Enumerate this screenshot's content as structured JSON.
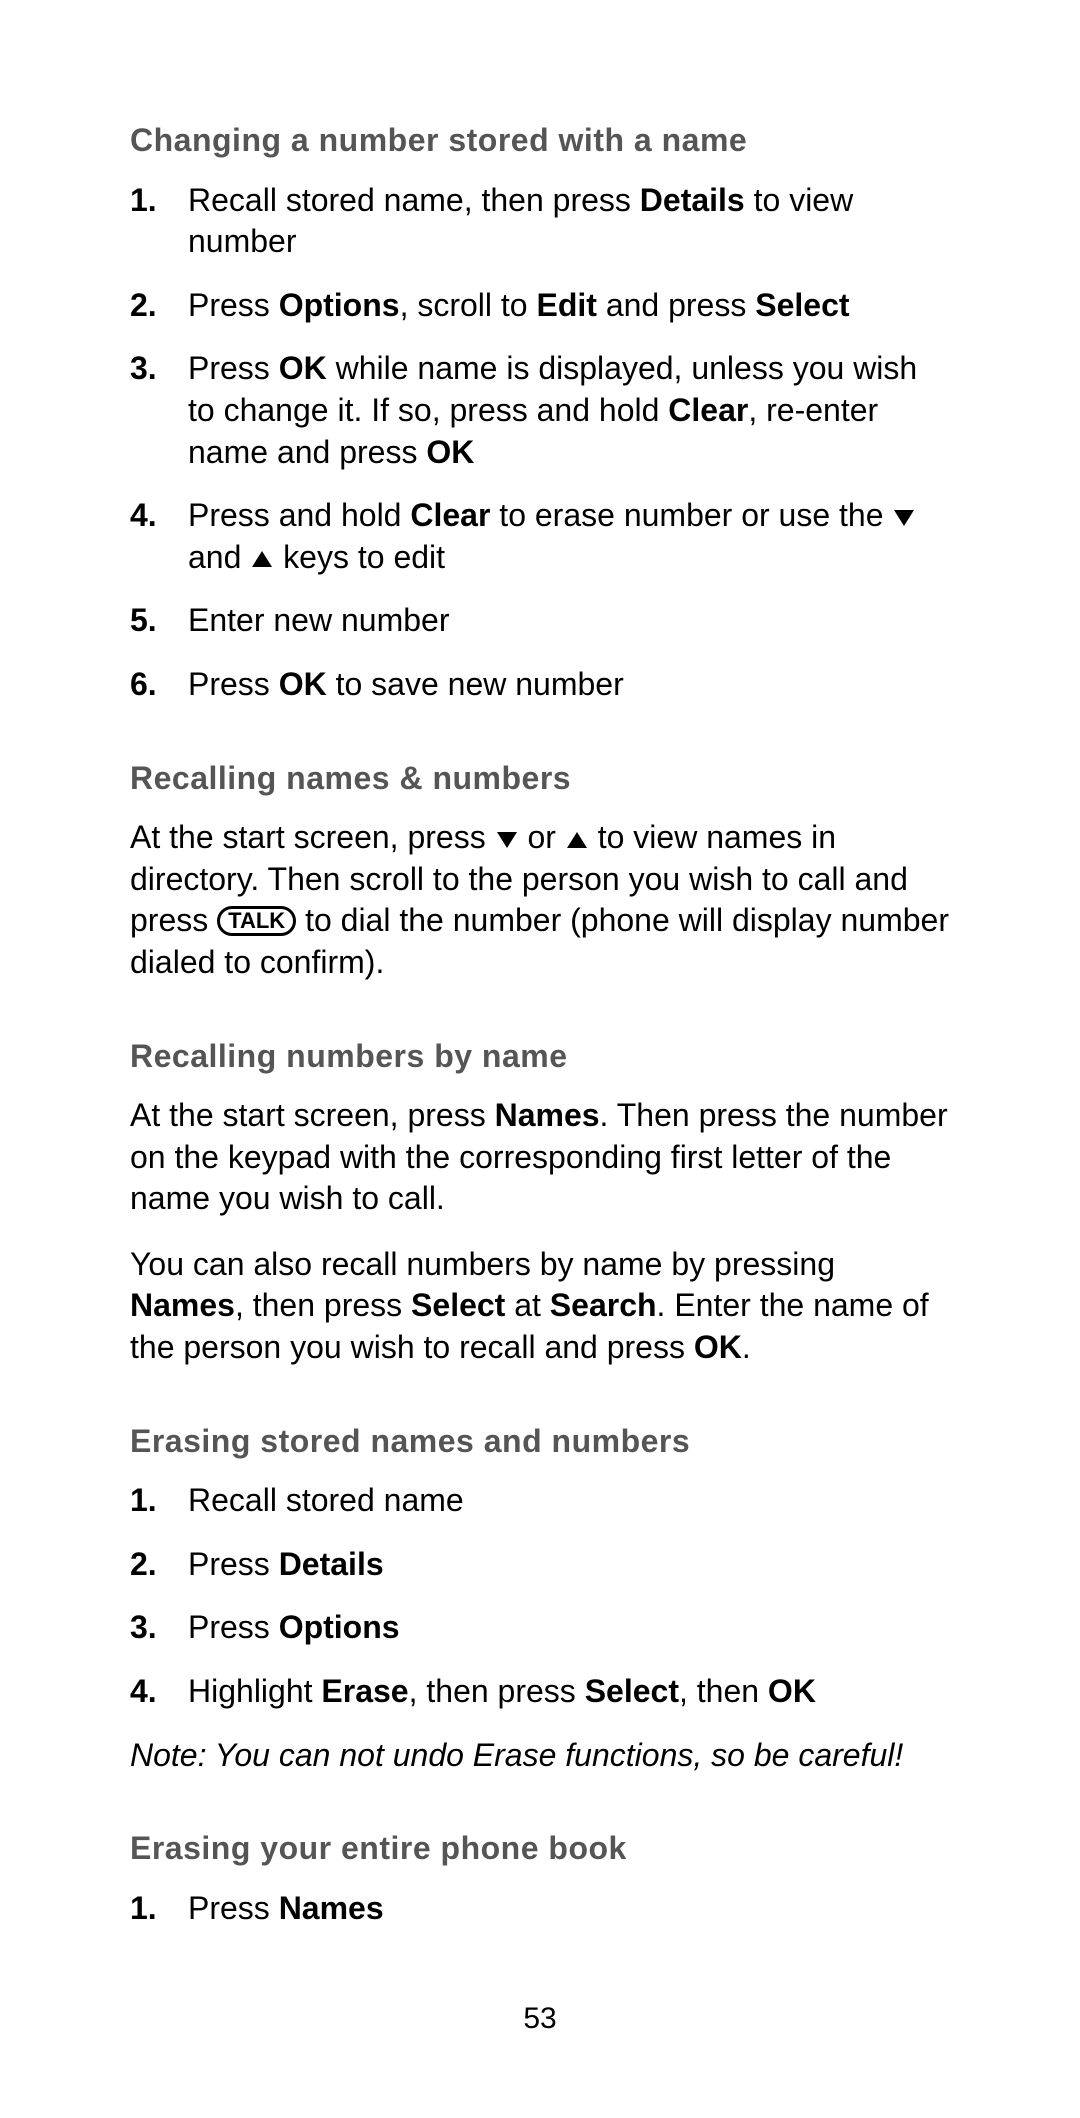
{
  "sections": {
    "s1": {
      "heading": "Changing a number stored with a name",
      "items": {
        "i1a": "Recall stored name, then press ",
        "i1b": "Details",
        "i1c": " to view number",
        "i2a": "Press ",
        "i2b": "Options",
        "i2c": ", scroll to ",
        "i2d": "Edit",
        "i2e": " and press ",
        "i2f": "Select",
        "i3a": "Press ",
        "i3b": "OK",
        "i3c": " while name is displayed, unless you wish to change it. If so, press and hold ",
        "i3d": "Clear",
        "i3e": ", re-enter name and press ",
        "i3f": "OK",
        "i4a": "Press and hold ",
        "i4b": "Clear",
        "i4c": " to erase number or use the ",
        "i4d": " and ",
        "i4e": " keys to edit",
        "i5": "Enter new number",
        "i6a": "Press ",
        "i6b": "OK",
        "i6c": " to save new number"
      }
    },
    "s2": {
      "heading": "Recalling names & numbers",
      "p1a": "At the start screen, press ",
      "p1b": " or ",
      "p1c": " to view names in directory. Then scroll to the person you wish to call and press ",
      "p1talk": "TALK",
      "p1d": " to dial the number (phone will display number dialed to confirm)."
    },
    "s3": {
      "heading": "Recalling numbers by name",
      "p1a": "At the start screen, press ",
      "p1b": "Names",
      "p1c": ". Then press the number on the keypad with the corresponding first letter of the name you wish to call.",
      "p2a": "You can also recall numbers by name by pressing ",
      "p2b": "Names",
      "p2c": ", then press ",
      "p2d": "Select",
      "p2e": " at ",
      "p2f": "Search",
      "p2g": ". Enter the name of the person you wish to recall and press ",
      "p2h": "OK",
      "p2i": "."
    },
    "s4": {
      "heading": "Erasing stored names and numbers",
      "items": {
        "i1": "Recall stored name",
        "i2a": "Press ",
        "i2b": "Details",
        "i3a": "Press ",
        "i3b": "Options",
        "i4a": "Highlight ",
        "i4b": "Erase",
        "i4c": ", then press ",
        "i4d": "Select",
        "i4e": ", then ",
        "i4f": "OK"
      },
      "note": "Note: You can not undo Erase functions, so be careful!"
    },
    "s5": {
      "heading": "Erasing your entire phone book",
      "items": {
        "i1a": "Press ",
        "i1b": "Names"
      }
    }
  },
  "page_number": "53"
}
